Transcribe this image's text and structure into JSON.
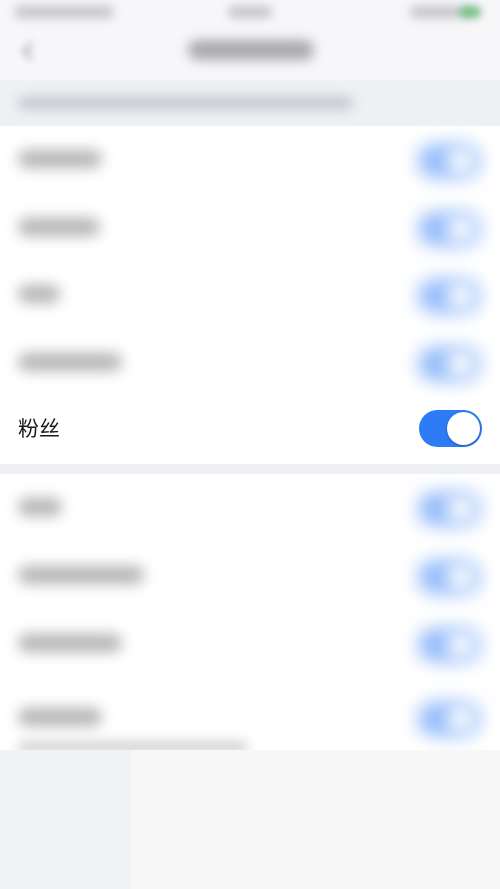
{
  "focused_row": {
    "label": "粉丝",
    "toggle_on": true,
    "toggle_color": "#2d7cf6"
  },
  "icons": {
    "back": "chevron-left-icon"
  }
}
